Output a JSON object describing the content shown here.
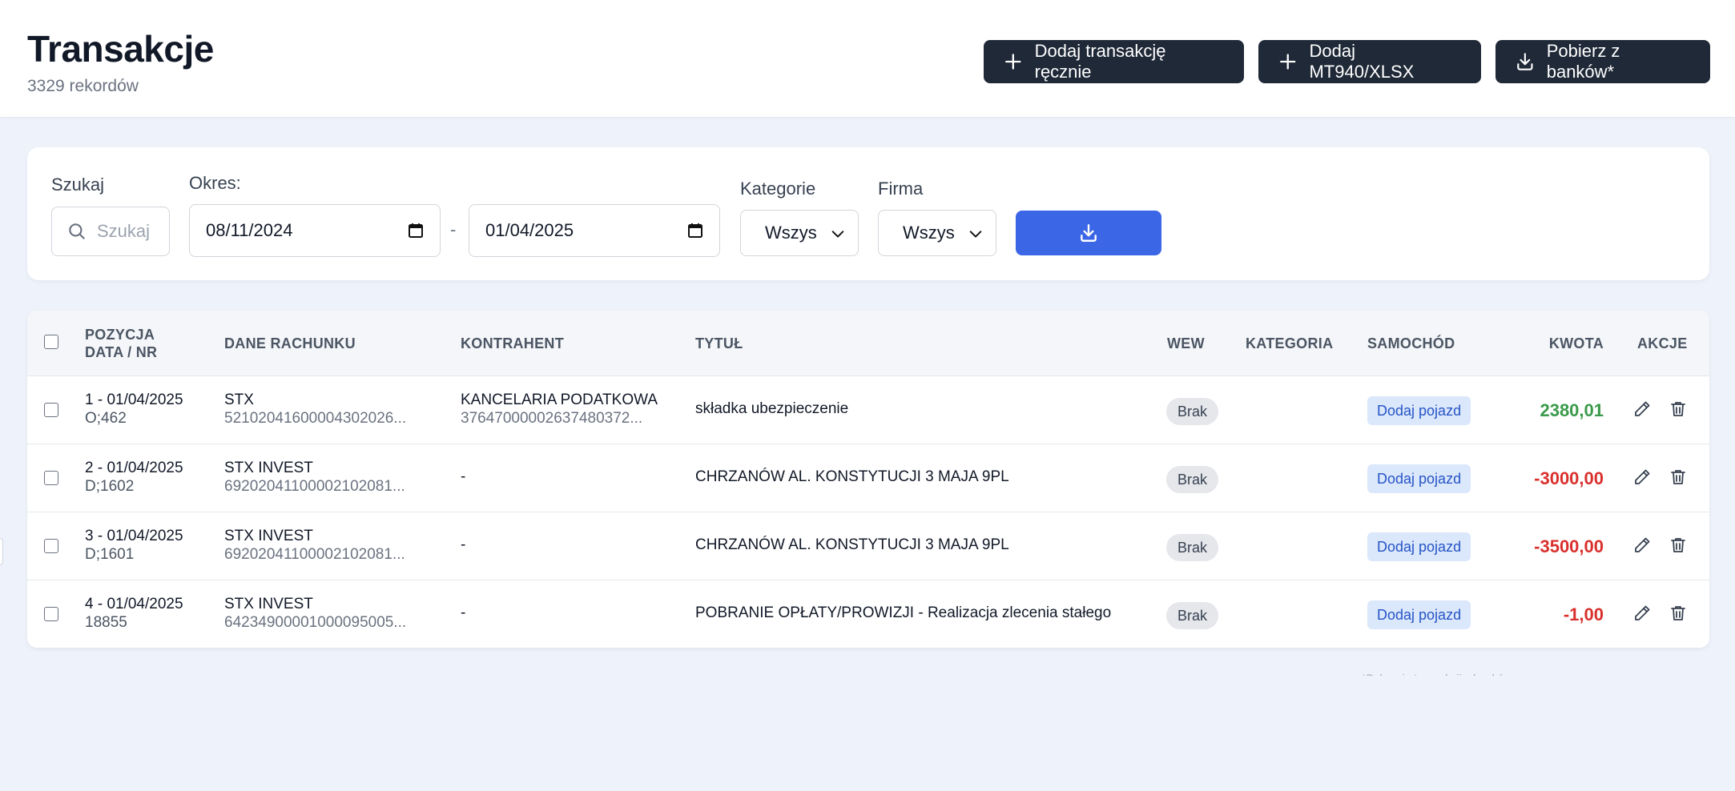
{
  "header": {
    "title": "Transakcje",
    "subtitle": "3329 rekordów",
    "buttons": {
      "manual": "Dodaj transakcję ręcznie",
      "mt940": "Dodaj MT940/XLSX",
      "banks": "Pobierz z banków*"
    }
  },
  "filters": {
    "search_label": "Szukaj",
    "search_placeholder": "Szukaj",
    "period_label": "Okres:",
    "date_from": "08/11/2024",
    "date_separator": "-",
    "date_to": "01/04/2025",
    "category_label": "Kategorie",
    "category_value": "Wszys",
    "firm_label": "Firma",
    "firm_value": "Wszys"
  },
  "table": {
    "headers": {
      "position_line1": "POZYCJA",
      "position_line2": "DATA / NR",
      "account": "DANE RACHUNKU",
      "counterparty": "KONTRAHENT",
      "title": "TYTUŁ",
      "internal": "WEW",
      "category": "KATEGORIA",
      "car": "SAMOCHÓD",
      "amount": "KWOTA",
      "actions": "AKCJE"
    },
    "rows": [
      {
        "pos": "1 - 01/04/2025",
        "nr": "O;462",
        "account_name": "STX",
        "account_no": "52102041600004302026...",
        "counterparty_name": "KANCELARIA PODATKOWA",
        "counterparty_no": "37647000002637480372...",
        "title": "składka ubezpieczenie",
        "internal": "Brak",
        "car": "Dodaj pojazd",
        "amount": "2380,01",
        "amount_color": "#3a9a4a"
      },
      {
        "pos": "2 - 01/04/2025",
        "nr": "D;1602",
        "account_name": "STX INVEST",
        "account_no": "69202041100002102081...",
        "counterparty_name": "-",
        "counterparty_no": "",
        "title": "CHRZANÓW AL. KONSTYTUCJI 3 MAJA 9PL",
        "internal": "Brak",
        "car": "Dodaj pojazd",
        "amount": "-3000,00",
        "amount_color": "#d9302c"
      },
      {
        "pos": "3 - 01/04/2025",
        "nr": "D;1601",
        "account_name": "STX INVEST",
        "account_no": "69202041100002102081...",
        "counterparty_name": "-",
        "counterparty_no": "",
        "title": "CHRZANÓW AL. KONSTYTUCJI 3 MAJA 9PL",
        "internal": "Brak",
        "car": "Dodaj pojazd",
        "amount": "-3500,00",
        "amount_color": "#d9302c"
      },
      {
        "pos": "4 - 01/04/2025",
        "nr": "18855",
        "account_name": "STX INVEST",
        "account_no": "64234900001000095005...",
        "counterparty_name": "-",
        "counterparty_no": "",
        "title": "POBRANIE OPŁATY/PROWIZJI - Realizacja zlecenia stałego",
        "internal": "Brak",
        "car": "Dodaj pojazd",
        "amount": "-1,00",
        "amount_color": "#d9302c"
      }
    ]
  },
  "footnote": "*Pobranie transakcji z banków...",
  "icons": {
    "add": "plus-icon",
    "download": "download-icon",
    "search": "search-icon",
    "calendar": "calendar-icon",
    "chevron": "chevron-down-icon",
    "edit": "pencil-icon",
    "delete": "trash-icon"
  },
  "colors": {
    "primary_dark": "#1f2937",
    "accent_blue": "#3b66e6",
    "positive": "#3a9a4a",
    "negative": "#d9302c",
    "background": "#eef2fb"
  }
}
